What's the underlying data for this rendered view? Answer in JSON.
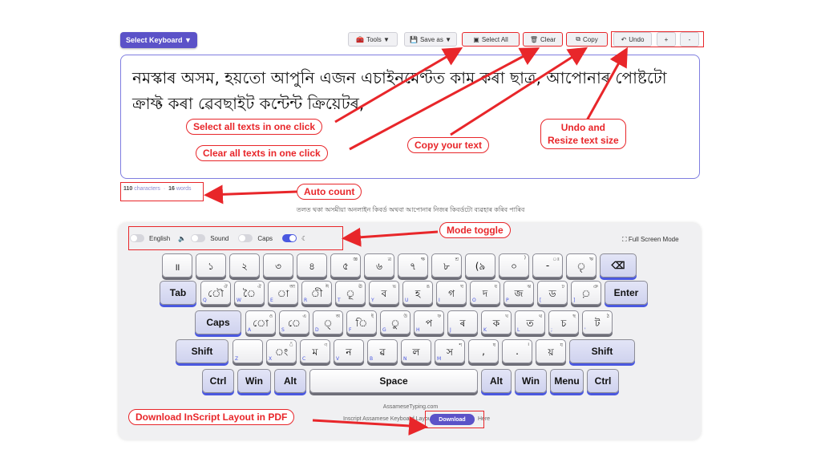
{
  "toolbar": {
    "select_keyboard": "Select Keyboard ▼",
    "tools": "Tools ▼",
    "save_as": "Save as ▼",
    "select_all": "Select All",
    "clear": "Clear",
    "copy": "Copy",
    "undo": "Undo",
    "plus": "+",
    "minus": "-"
  },
  "editor": {
    "text": "নমস্কাৰ অসম, হয়তো আপুনি এজন এচাইনমেণ্টত কাম কৰা ছাত্ৰ, আপোনাৰ পোষ্টটো ক্ৰাফ্ট কৰা ৱেবছাইট কন্টেন্ট ক্ৰিয়েটৰ,"
  },
  "counter": {
    "characters": "110",
    "characters_label": "characters",
    "words": "16",
    "words_label": "words"
  },
  "hint": "তলত থকা অসমীয়া অনলাইন কিবৰ্ড অথবা আপোনাৰ নিজৰ কিবৰ্ডটো ব্যৱহাৰ কৰিব পাৰিব",
  "toggles": {
    "english": "English",
    "sound": "Sound",
    "caps": "Caps"
  },
  "fullscreen": "Full Screen Mode",
  "annotations": {
    "select_all": "Select all texts in one click",
    "clear_all": "Clear all texts in one click",
    "copy": "Copy your text",
    "undo_line1": "Undo and",
    "undo_line2": "Resize text size",
    "auto_count": "Auto count",
    "mode_toggle": "Mode toggle",
    "download": "Download InScript Layout in PDF"
  },
  "footer": {
    "brand": "AssameseTyping.com",
    "layout_text": "Inscript Assamese Keyboard Layout",
    "download_button": "Download",
    "here": "Here"
  },
  "keyboard": {
    "row1": [
      {
        "m": "॥",
        "s": "",
        "e": ""
      },
      {
        "m": "১",
        "s": "",
        "e": ""
      },
      {
        "m": "২",
        "s": "",
        "e": ""
      },
      {
        "m": "৩",
        "s": "",
        "e": ""
      },
      {
        "m": "৪",
        "s": "",
        "e": ""
      },
      {
        "m": "৫",
        "s": "জ্ঞ",
        "e": ""
      },
      {
        "m": "৬",
        "s": "ত্ৰ",
        "e": ""
      },
      {
        "m": "৭",
        "s": "ক্ষ",
        "e": ""
      },
      {
        "m": "৮",
        "s": "শ্ৰ",
        "e": ""
      },
      {
        "m": "(৯",
        "s": "",
        "e": ""
      },
      {
        "m": "০",
        "s": ")",
        "e": ""
      },
      {
        "m": "-",
        "s": "ঃ",
        "e": ""
      },
      {
        "m": "ৃ",
        "s": "ঋ",
        "e": ""
      }
    ],
    "backspace": "⌫",
    "tab": "Tab",
    "row2": [
      {
        "m": "ৌ",
        "s": "ঔ",
        "e": "Q"
      },
      {
        "m": "ৈ",
        "s": "ঐ",
        "e": "W"
      },
      {
        "m": "া",
        "s": "আ",
        "e": "E"
      },
      {
        "m": "ী",
        "s": "ঈ",
        "e": "R"
      },
      {
        "m": "ূ",
        "s": "ঊ",
        "e": "T"
      },
      {
        "m": "ব",
        "s": "ভ",
        "e": "Y"
      },
      {
        "m": "হ",
        "s": "ঙ",
        "e": "U"
      },
      {
        "m": "গ",
        "s": "ঘ",
        "e": "I"
      },
      {
        "m": "দ",
        "s": "ধ",
        "e": "O"
      },
      {
        "m": "জ",
        "s": "ঝ",
        "e": "P"
      },
      {
        "m": "ড",
        "s": "ঢ",
        "e": "["
      },
      {
        "m": "়",
        "s": "ঞ",
        "e": "]"
      }
    ],
    "enter": "Enter",
    "caps": "Caps",
    "row3": [
      {
        "m": "ো",
        "s": "ও",
        "e": "A"
      },
      {
        "m": "ে",
        "s": "এ",
        "e": "S"
      },
      {
        "m": "্",
        "s": "অ",
        "e": "D"
      },
      {
        "m": "ি",
        "s": "ই",
        "e": "F"
      },
      {
        "m": "ু",
        "s": "উ",
        "e": "G"
      },
      {
        "m": "প",
        "s": "ফ",
        "e": "H"
      },
      {
        "m": "ৰ",
        "s": "",
        "e": "J"
      },
      {
        "m": "ক",
        "s": "খ",
        "e": "K"
      },
      {
        "m": "ত",
        "s": "থ",
        "e": "L"
      },
      {
        "m": "চ",
        "s": "ছ",
        "e": ";"
      },
      {
        "m": "ট",
        "s": "ঠ",
        "e": "'"
      }
    ],
    "shift_left": "Shift",
    "row4": [
      {
        "m": "",
        "s": "",
        "e": "Z"
      },
      {
        "m": "ং",
        "s": "ঁ",
        "e": "X"
      },
      {
        "m": "ম",
        "s": "ণ",
        "e": "C"
      },
      {
        "m": "ন",
        "s": "",
        "e": "V"
      },
      {
        "m": "ৱ",
        "s": "",
        "e": "B"
      },
      {
        "m": "ল",
        "s": "",
        "e": "N"
      },
      {
        "m": "স",
        "s": "শ",
        "e": "M"
      },
      {
        "m": ",",
        "s": "ষ",
        "e": ""
      },
      {
        "m": ".",
        "s": "।",
        "e": ""
      },
      {
        "m": "য়",
        "s": "য",
        "e": ""
      }
    ],
    "shift_right": "Shift",
    "ctrl": "Ctrl",
    "win": "Win",
    "alt": "Alt",
    "space": "Space",
    "alt_r": "Alt",
    "win_r": "Win",
    "menu": "Menu",
    "ctrl_r": "Ctrl"
  }
}
